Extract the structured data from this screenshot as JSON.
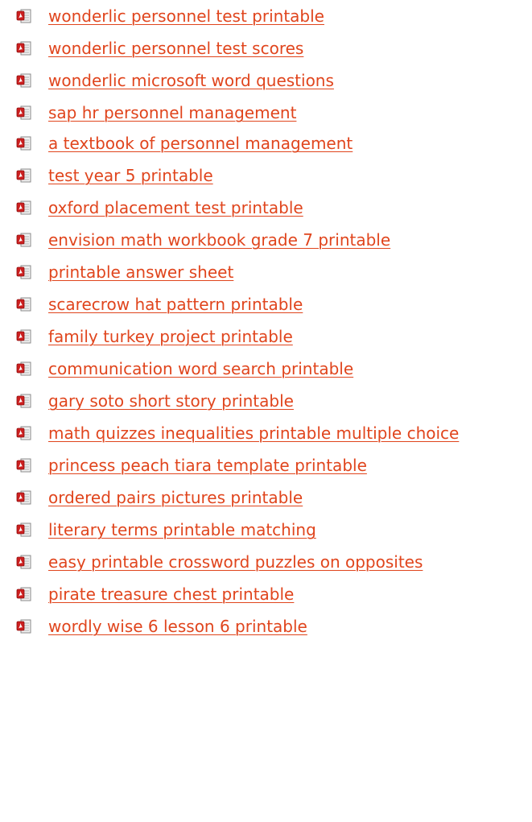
{
  "colors": {
    "link": "#e0451d",
    "icon_red": "#cc1f1f",
    "icon_page": "#f2f2f2"
  },
  "links": [
    {
      "label": "wonderlic personnel test printable",
      "icon": "pdf-file-icon"
    },
    {
      "label": "wonderlic personnel test scores",
      "icon": "pdf-file-icon"
    },
    {
      "label": "wonderlic microsoft word questions",
      "icon": "pdf-file-icon"
    },
    {
      "label": "sap hr personnel management",
      "icon": "pdf-file-icon"
    },
    {
      "label": "a textbook of personnel management",
      "icon": "pdf-file-icon"
    },
    {
      "label": "test year 5 printable",
      "icon": "pdf-file-icon"
    },
    {
      "label": "oxford placement test printable",
      "icon": "pdf-file-icon"
    },
    {
      "label": "envision math workbook grade 7 printable",
      "icon": "pdf-file-icon"
    },
    {
      "label": "printable answer sheet",
      "icon": "pdf-file-icon"
    },
    {
      "label": "scarecrow hat pattern printable",
      "icon": "pdf-file-icon"
    },
    {
      "label": "family turkey project printable",
      "icon": "pdf-file-icon"
    },
    {
      "label": "communication word search printable",
      "icon": "pdf-file-icon"
    },
    {
      "label": "gary soto short story printable",
      "icon": "pdf-file-icon"
    },
    {
      "label": "math quizzes inequalities printable multiple choice",
      "icon": "pdf-file-icon"
    },
    {
      "label": "princess peach tiara template printable",
      "icon": "pdf-file-icon"
    },
    {
      "label": "ordered pairs pictures printable",
      "icon": "pdf-file-icon"
    },
    {
      "label": "literary terms printable matching",
      "icon": "pdf-file-icon"
    },
    {
      "label": "easy printable crossword puzzles on opposites",
      "icon": "pdf-file-icon"
    },
    {
      "label": "pirate treasure chest printable",
      "icon": "pdf-file-icon"
    },
    {
      "label": "wordly wise 6 lesson 6 printable",
      "icon": "pdf-file-icon"
    }
  ]
}
